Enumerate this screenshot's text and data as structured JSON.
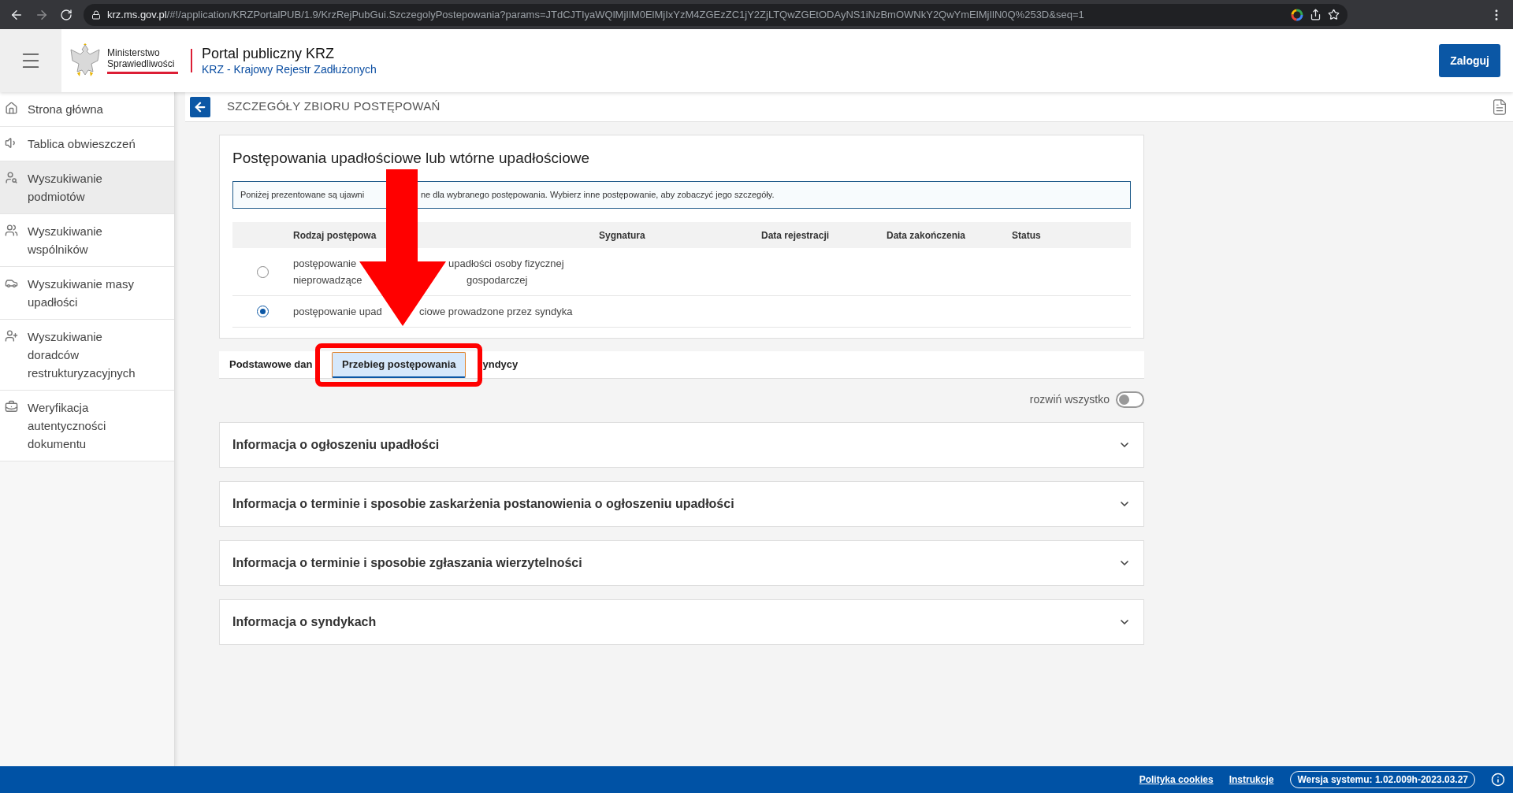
{
  "browser": {
    "host": "krz.ms.gov.pl",
    "path": "/#!/application/KRZPortalPUB/1.9/KrzRejPubGui.SzczegolyPostepowania?params=JTdCJTIyaWQlMjIlM0ElMjIxYzM4ZGEzZC1jY2ZjLTQwZGEtODAyNS1iNzBmOWNkY2QwYmElMjIlN0Q%253D&seq=1"
  },
  "header": {
    "ministry": "Ministerstwo Sprawiedliwości",
    "title": "Portal publiczny KRZ",
    "subtitle": "KRZ - Krajowy Rejestr Zadłużonych",
    "login_button": "Zaloguj"
  },
  "sidebar": {
    "items": [
      {
        "label": "Strona główna",
        "selected": false
      },
      {
        "label": "Tablica obwieszczeń",
        "selected": false
      },
      {
        "label": "Wyszukiwanie podmiotów",
        "selected": true
      },
      {
        "label": "Wyszukiwanie wspólników",
        "selected": false
      },
      {
        "label": "Wyszukiwanie masy upadłości",
        "selected": false
      },
      {
        "label": "Wyszukiwanie doradców restrukturyzacyjnych",
        "selected": false
      },
      {
        "label": "Weryfikacja autentyczności dokumentu",
        "selected": false
      }
    ]
  },
  "page_title": "SZCZEGÓŁY ZBIORU POSTĘPOWAŃ",
  "section": {
    "title": "Postępowania upadłościowe lub wtórne upadłościowe",
    "info": [
      "Poniżej prezentowane są ujawni",
      "ne dla wybranego postępowania. Wybierz inne postępowanie, aby zobaczyć jego szczegóły."
    ],
    "columns": [
      "Rodzaj postępowa",
      "Sygnatura",
      "Data rejestracji",
      "Data zakończenia",
      "Status"
    ],
    "rows": [
      {
        "selected": false,
        "lines": [
          [
            "postępowanie",
            "upadłości osoby fizycznej"
          ],
          [
            "nieprowadzące",
            "gospodarczej"
          ]
        ]
      },
      {
        "selected": true,
        "lines": [
          [
            "postępowanie upad",
            "ciowe prowadzone przez syndyka"
          ]
        ]
      }
    ]
  },
  "tabs": [
    {
      "label": "Podstawowe dan",
      "selected": false
    },
    {
      "label": "Przebieg postępowania",
      "selected": true
    },
    {
      "label": "yndycy",
      "selected": false
    }
  ],
  "expand_all": {
    "label": "rozwiń wszystko",
    "on": false
  },
  "accordions": [
    {
      "title": "Informacja o ogłoszeniu upadłości",
      "expanded": false
    },
    {
      "title": "Informacja o terminie i sposobie zaskarżenia postanowienia o ogłoszeniu upadłości",
      "expanded": false
    },
    {
      "title": "Informacja o terminie i sposobie zgłaszania wierzytelności",
      "expanded": false
    },
    {
      "title": "Informacja o syndykach",
      "expanded": false
    }
  ],
  "footer": {
    "links": [
      "Polityka cookies",
      "Instrukcje"
    ],
    "version": "Wersja systemu: 1.02.009h-2023.03.27"
  }
}
